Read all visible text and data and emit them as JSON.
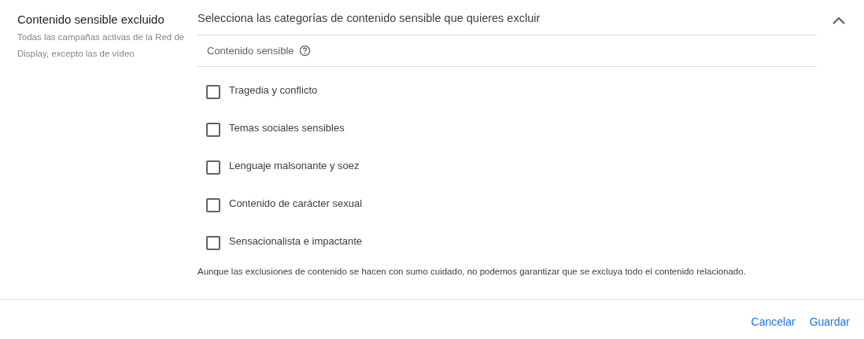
{
  "section": {
    "title": "Contenido sensible excluido",
    "description": "Todas las campañas activas de la Red de Display, excepto las de vídeo"
  },
  "panel": {
    "heading": "Selecciona las categorías de contenido sensible que quieres excluir",
    "expanded": true,
    "column_header": "Contenido sensible",
    "options": [
      {
        "label": "Tragedia y conflicto",
        "checked": false
      },
      {
        "label": "Temas sociales sensibles",
        "checked": false
      },
      {
        "label": "Lenguaje malsonante y soez",
        "checked": false
      },
      {
        "label": "Contenido de carácter sexual",
        "checked": false
      },
      {
        "label": "Sensacionalista e impactante",
        "checked": false
      }
    ],
    "note": "Aunque las exclusiones de contenido se hacen con sumo cuidado, no podemos garantizar que se excluya todo el contenido relacionado."
  },
  "buttons": [
    "Cancelar",
    "Guardar"
  ]
}
